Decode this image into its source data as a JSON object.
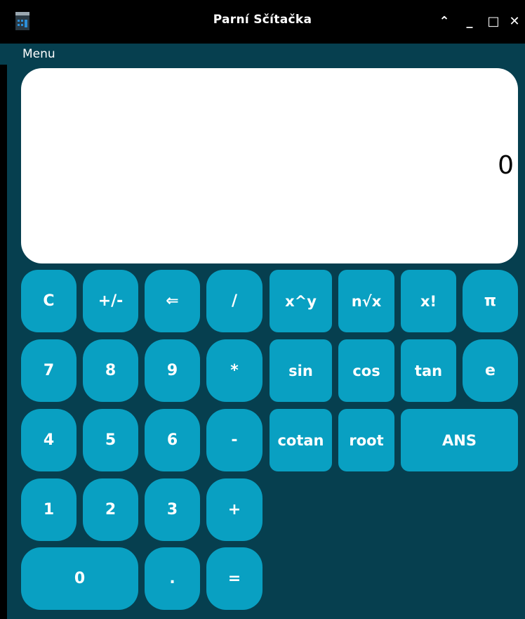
{
  "window": {
    "title": "Parní Sčítačka",
    "controls": {
      "collapse": "⌃",
      "minimize": "_",
      "maximize": "□",
      "close": "✕"
    }
  },
  "menu": {
    "label": "Menu"
  },
  "display": {
    "value": "0"
  },
  "keys": {
    "clear": "C",
    "sign": "+/-",
    "backspace": "⇐",
    "divide": "/",
    "power": "x^y",
    "nth_root": "n√x",
    "factorial": "x!",
    "pi": "π",
    "seven": "7",
    "eight": "8",
    "nine": "9",
    "multiply": "*",
    "sin": "sin",
    "cos": "cos",
    "tan": "tan",
    "e": "e",
    "four": "4",
    "five": "5",
    "six": "6",
    "subtract": "-",
    "cotan": "cotan",
    "root": "root",
    "ans": "ANS",
    "one": "1",
    "two": "2",
    "three": "3",
    "add": "+",
    "zero": "0",
    "decimal": ".",
    "equals": "="
  },
  "colors": {
    "background": "#063f4f",
    "key": "#09a0c2",
    "display": "#ffffff",
    "titlebar": "#000000"
  }
}
